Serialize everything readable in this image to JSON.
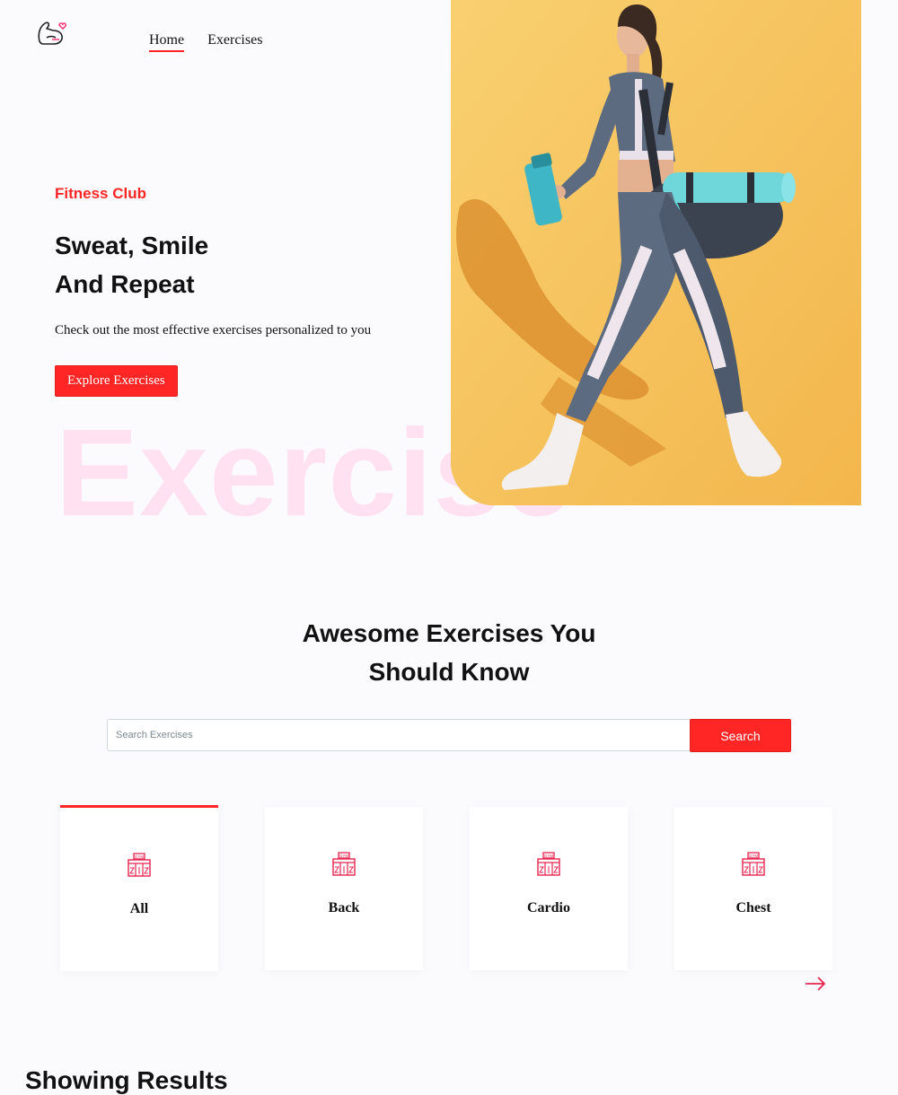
{
  "nav": {
    "logo_icon": "flexed-arm-heart-icon",
    "links": [
      {
        "label": "Home",
        "active": true
      },
      {
        "label": "Exercises",
        "active": false
      }
    ]
  },
  "hero": {
    "tagline": "Fitness Club",
    "headline_line1": "Sweat, Smile",
    "headline_line2": "And Repeat",
    "subtitle": "Check out the most effective exercises personalized to you",
    "cta_label": "Explore Exercises",
    "watermark": "Exercise",
    "image_description_icon": "woman-walking-with-gym-bag-photo"
  },
  "search": {
    "title_line1": "Awesome Exercises You",
    "title_line2": "Should Know",
    "placeholder": "Search Exercises",
    "button_label": "Search"
  },
  "body_parts": {
    "icon": "gym-building-icon",
    "icon_text": "GYM",
    "items": [
      {
        "label": "All",
        "active": true
      },
      {
        "label": "Back",
        "active": false
      },
      {
        "label": "Cardio",
        "active": false
      },
      {
        "label": "Chest",
        "active": false
      }
    ],
    "next_icon": "arrow-right-icon"
  },
  "results": {
    "title": "Showing Results"
  },
  "colors": {
    "accent": "#ff2625",
    "watermark": "#ffe1f1",
    "hero_bg": "#f8c65a",
    "page_bg": "#fbfbfd"
  }
}
